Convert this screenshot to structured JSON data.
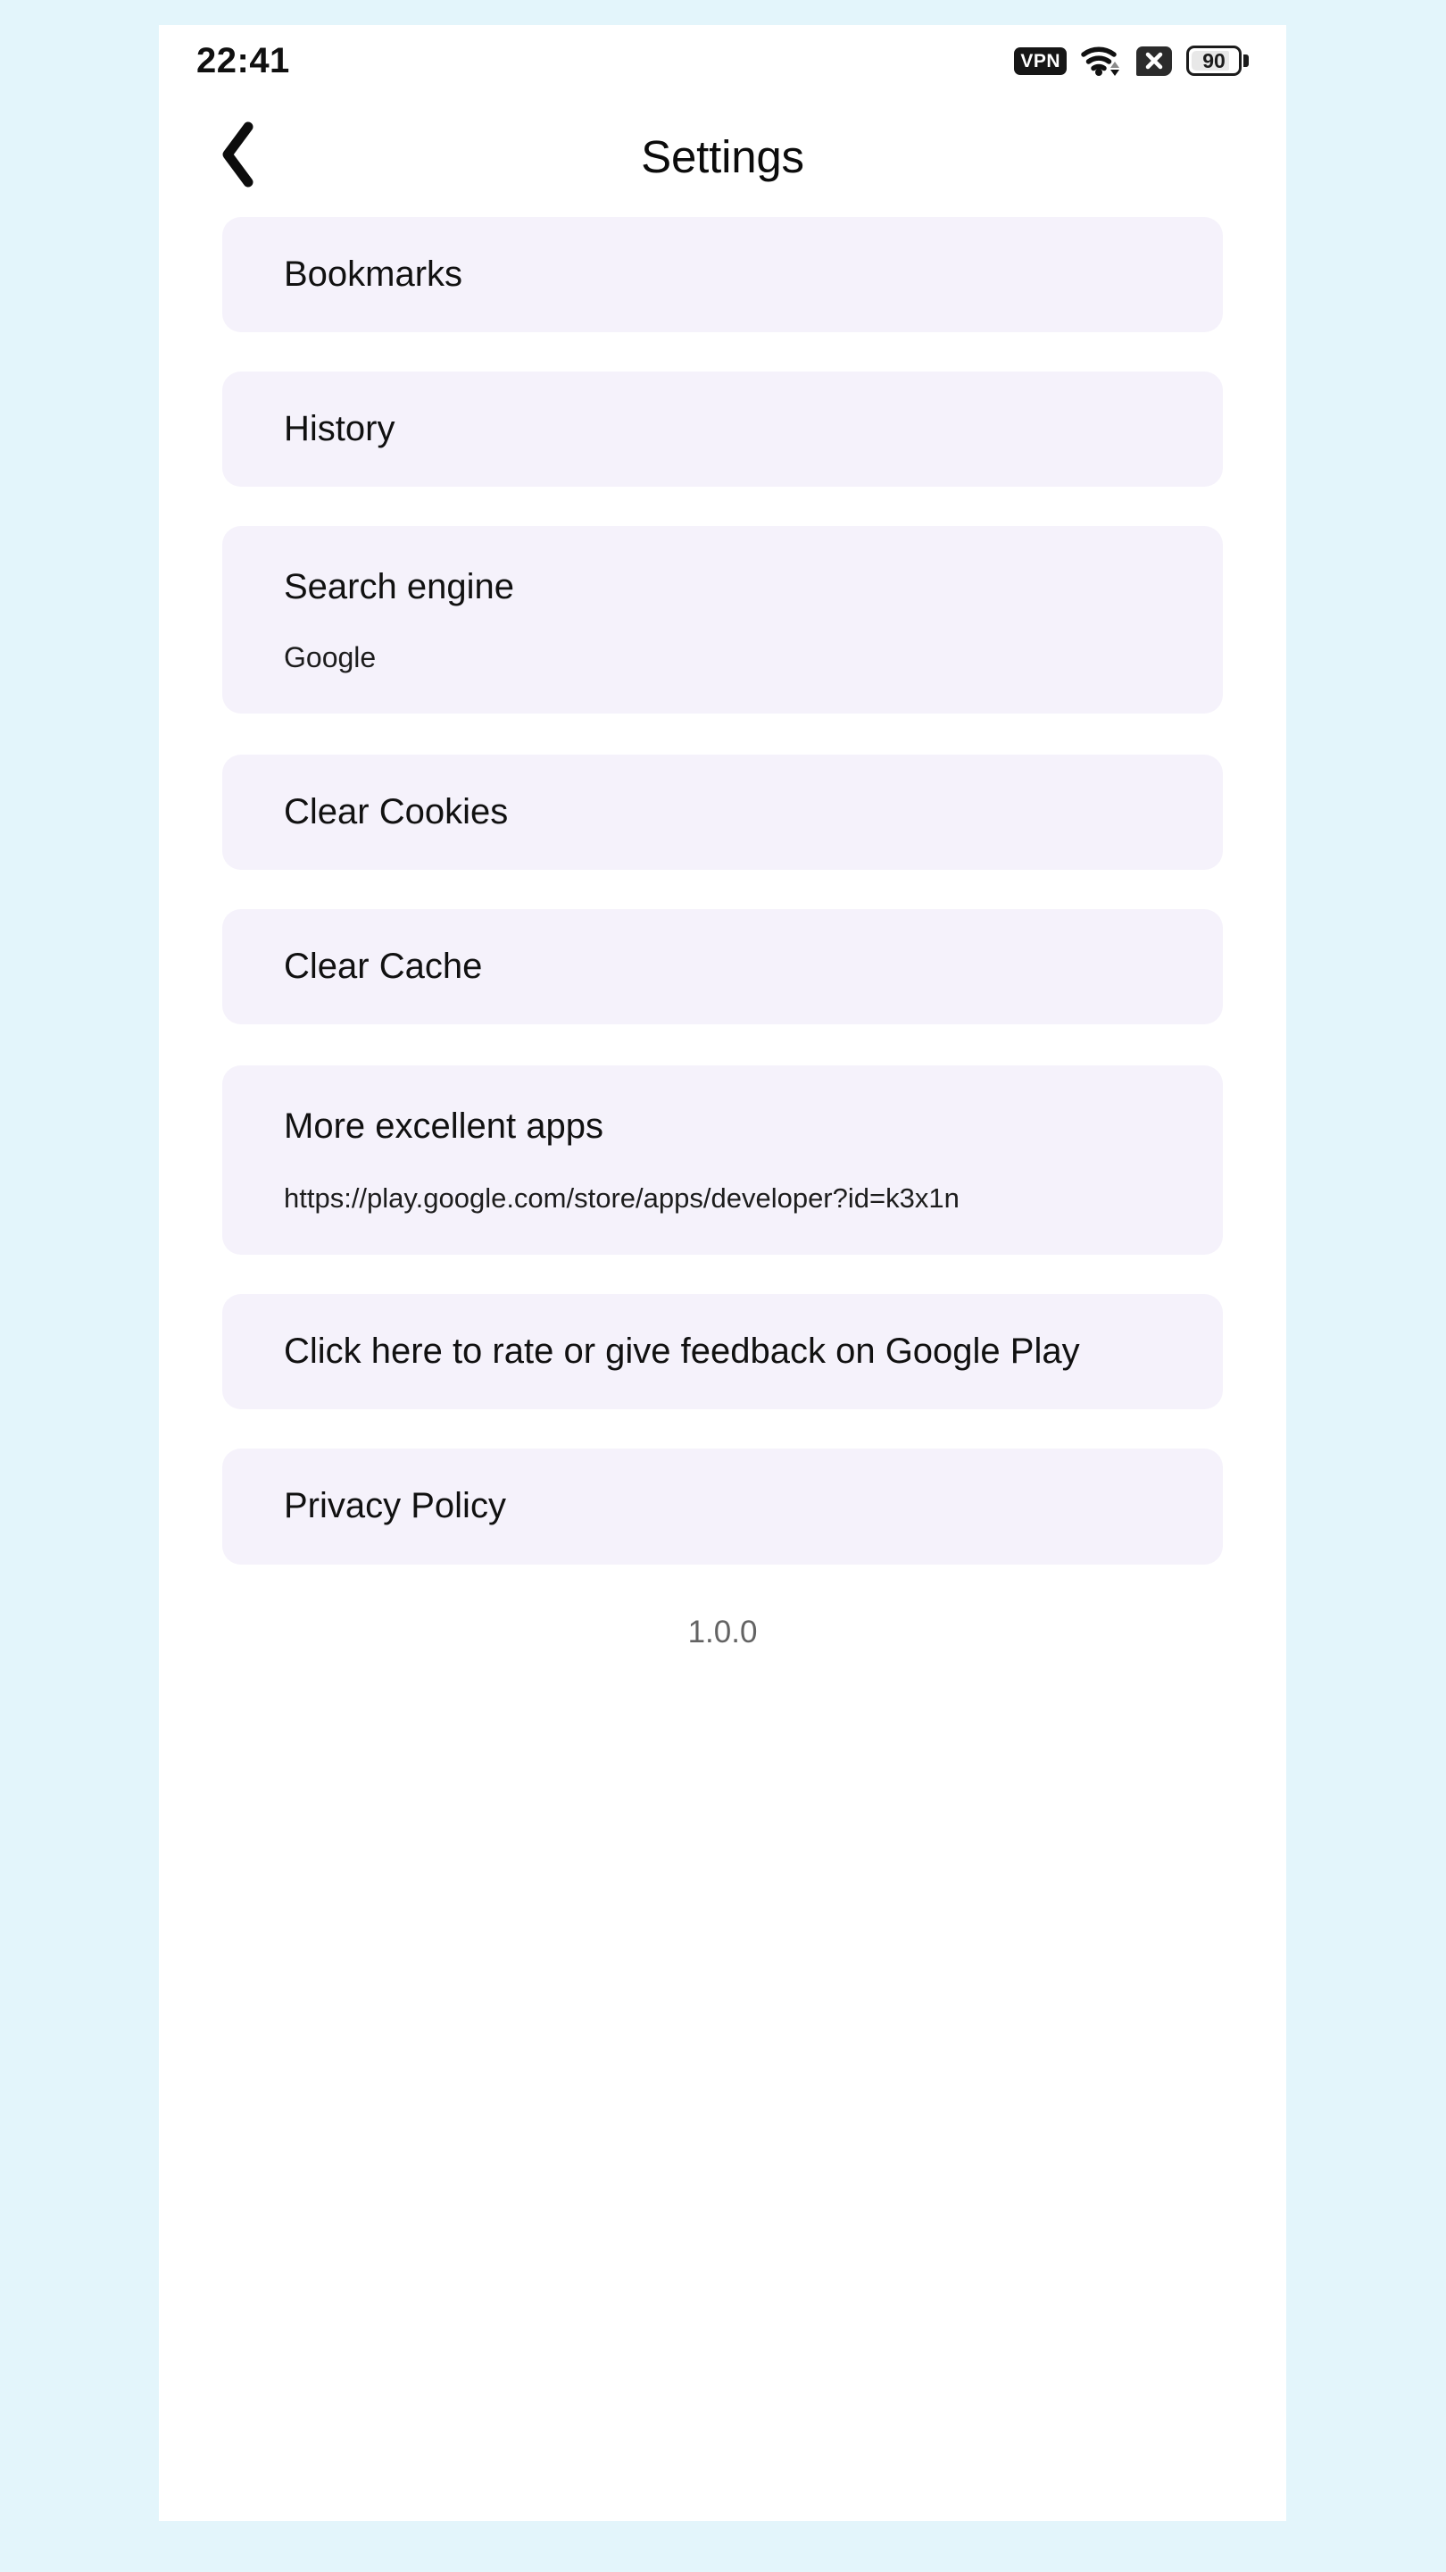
{
  "status_bar": {
    "time": "22:41",
    "vpn_label": "VPN",
    "battery_level": "90",
    "icons": [
      "vpn-badge",
      "wifi-icon",
      "signal-x-icon",
      "battery-icon"
    ]
  },
  "header": {
    "back_icon": "chevron-left-icon",
    "title": "Settings"
  },
  "groups": [
    {
      "items": [
        {
          "title": "Bookmarks",
          "subtitle": ""
        },
        {
          "title": "History",
          "subtitle": ""
        },
        {
          "title": "Search engine",
          "subtitle": "Google"
        }
      ]
    },
    {
      "items": [
        {
          "title": "Clear Cookies",
          "subtitle": ""
        },
        {
          "title": "Clear Cache",
          "subtitle": ""
        }
      ]
    },
    {
      "items": [
        {
          "title": "More excellent apps",
          "subtitle": "https://play.google.com/store/apps/developer?id=k3x1n"
        },
        {
          "title": "Click here to rate or give feedback on Google Play",
          "subtitle": ""
        },
        {
          "title": "Privacy Policy",
          "subtitle": ""
        }
      ]
    }
  ],
  "footer": {
    "version": "1.0.0"
  },
  "colors": {
    "page_background": "#e3f5fb",
    "screen_background": "#ffffff",
    "card_background": "#f5f2fb",
    "primary_text": "#111111",
    "muted_text": "#636363"
  }
}
